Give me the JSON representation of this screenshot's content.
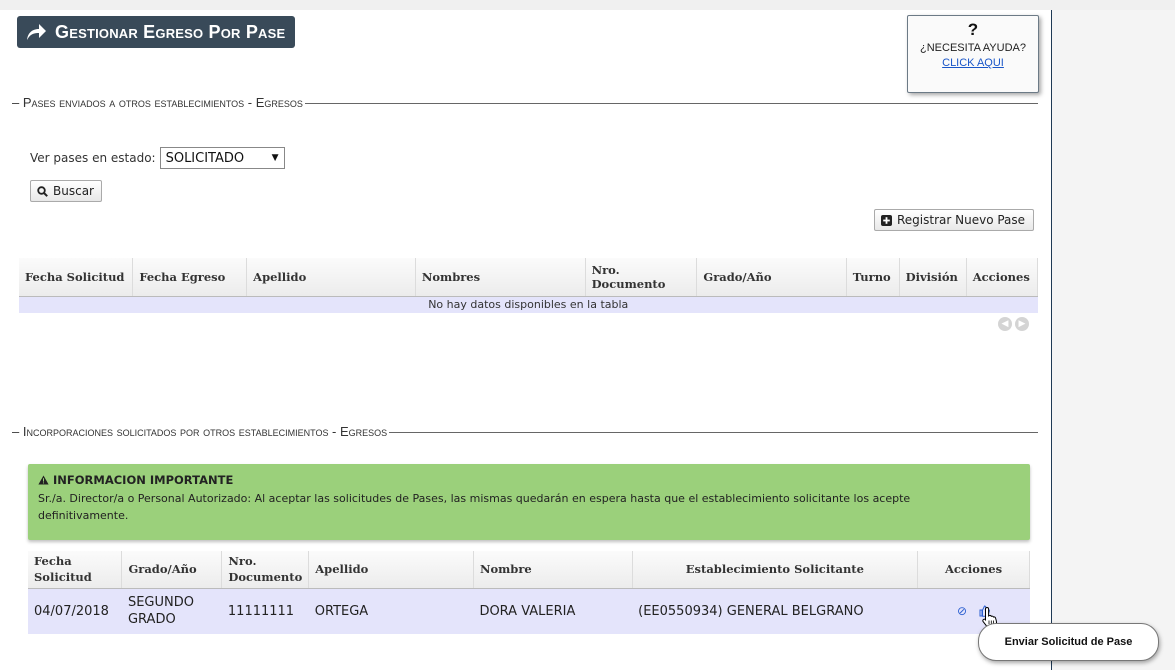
{
  "page": {
    "title": "Gestionar Egreso Por Pase"
  },
  "help": {
    "symbol": "?",
    "text": "¿NECESITA AYUDA?",
    "link": "CLICK AQUI"
  },
  "section1": {
    "legend": "Pases enviados a otros establecimientos - Egresos",
    "filter_label": "Ver pases en estado:",
    "filter_value": "SOLICITADO",
    "search_button": "Buscar",
    "register_button": "Registrar Nuevo Pase",
    "columns": [
      "Fecha Solicitud",
      "Fecha Egreso",
      "Apellido",
      "Nombres",
      "Nro. Documento",
      "Grado/Año",
      "Turno",
      "División",
      "Acciones"
    ],
    "empty_text": "No hay datos disponibles en la tabla"
  },
  "section2": {
    "legend": "Incorporaciones solicitados por otros establecimientos - Egresos",
    "info_title": "INFORMACION IMPORTANTE",
    "info_body": "Sr./a. Director/a o Personal Autorizado: Al aceptar las solicitudes de Pases, las mismas quedarán en espera hasta que el establecimiento solicitante los acepte definitivamente.",
    "columns": [
      "Fecha Solicitud",
      "Grado/Año",
      "Nro. Documento",
      "Apellido",
      "Nombre",
      "Establecimiento Solicitante",
      "Acciones"
    ],
    "rows": [
      {
        "fecha": "04/07/2018",
        "grado": "SEGUNDO GRADO",
        "documento": "11111111",
        "apellido": "ORTEGA",
        "nombre": "DORA VALERIA",
        "establecimiento": "(EE0550934) GENERAL BELGRANO"
      }
    ]
  },
  "tooltip": "Enviar Solicitud de Pase",
  "colors": {
    "title_bg": "#394a59",
    "info_bg": "#9bd07b",
    "row_bg": "#e4e4fb",
    "link": "#1a56c8"
  },
  "icons": [
    "share-arrow-icon",
    "search-icon",
    "plus-square-icon",
    "warning-icon",
    "reject-icon",
    "thumbs-up-icon",
    "hand-pointer-icon",
    "prev-page-icon",
    "next-page-icon"
  ]
}
